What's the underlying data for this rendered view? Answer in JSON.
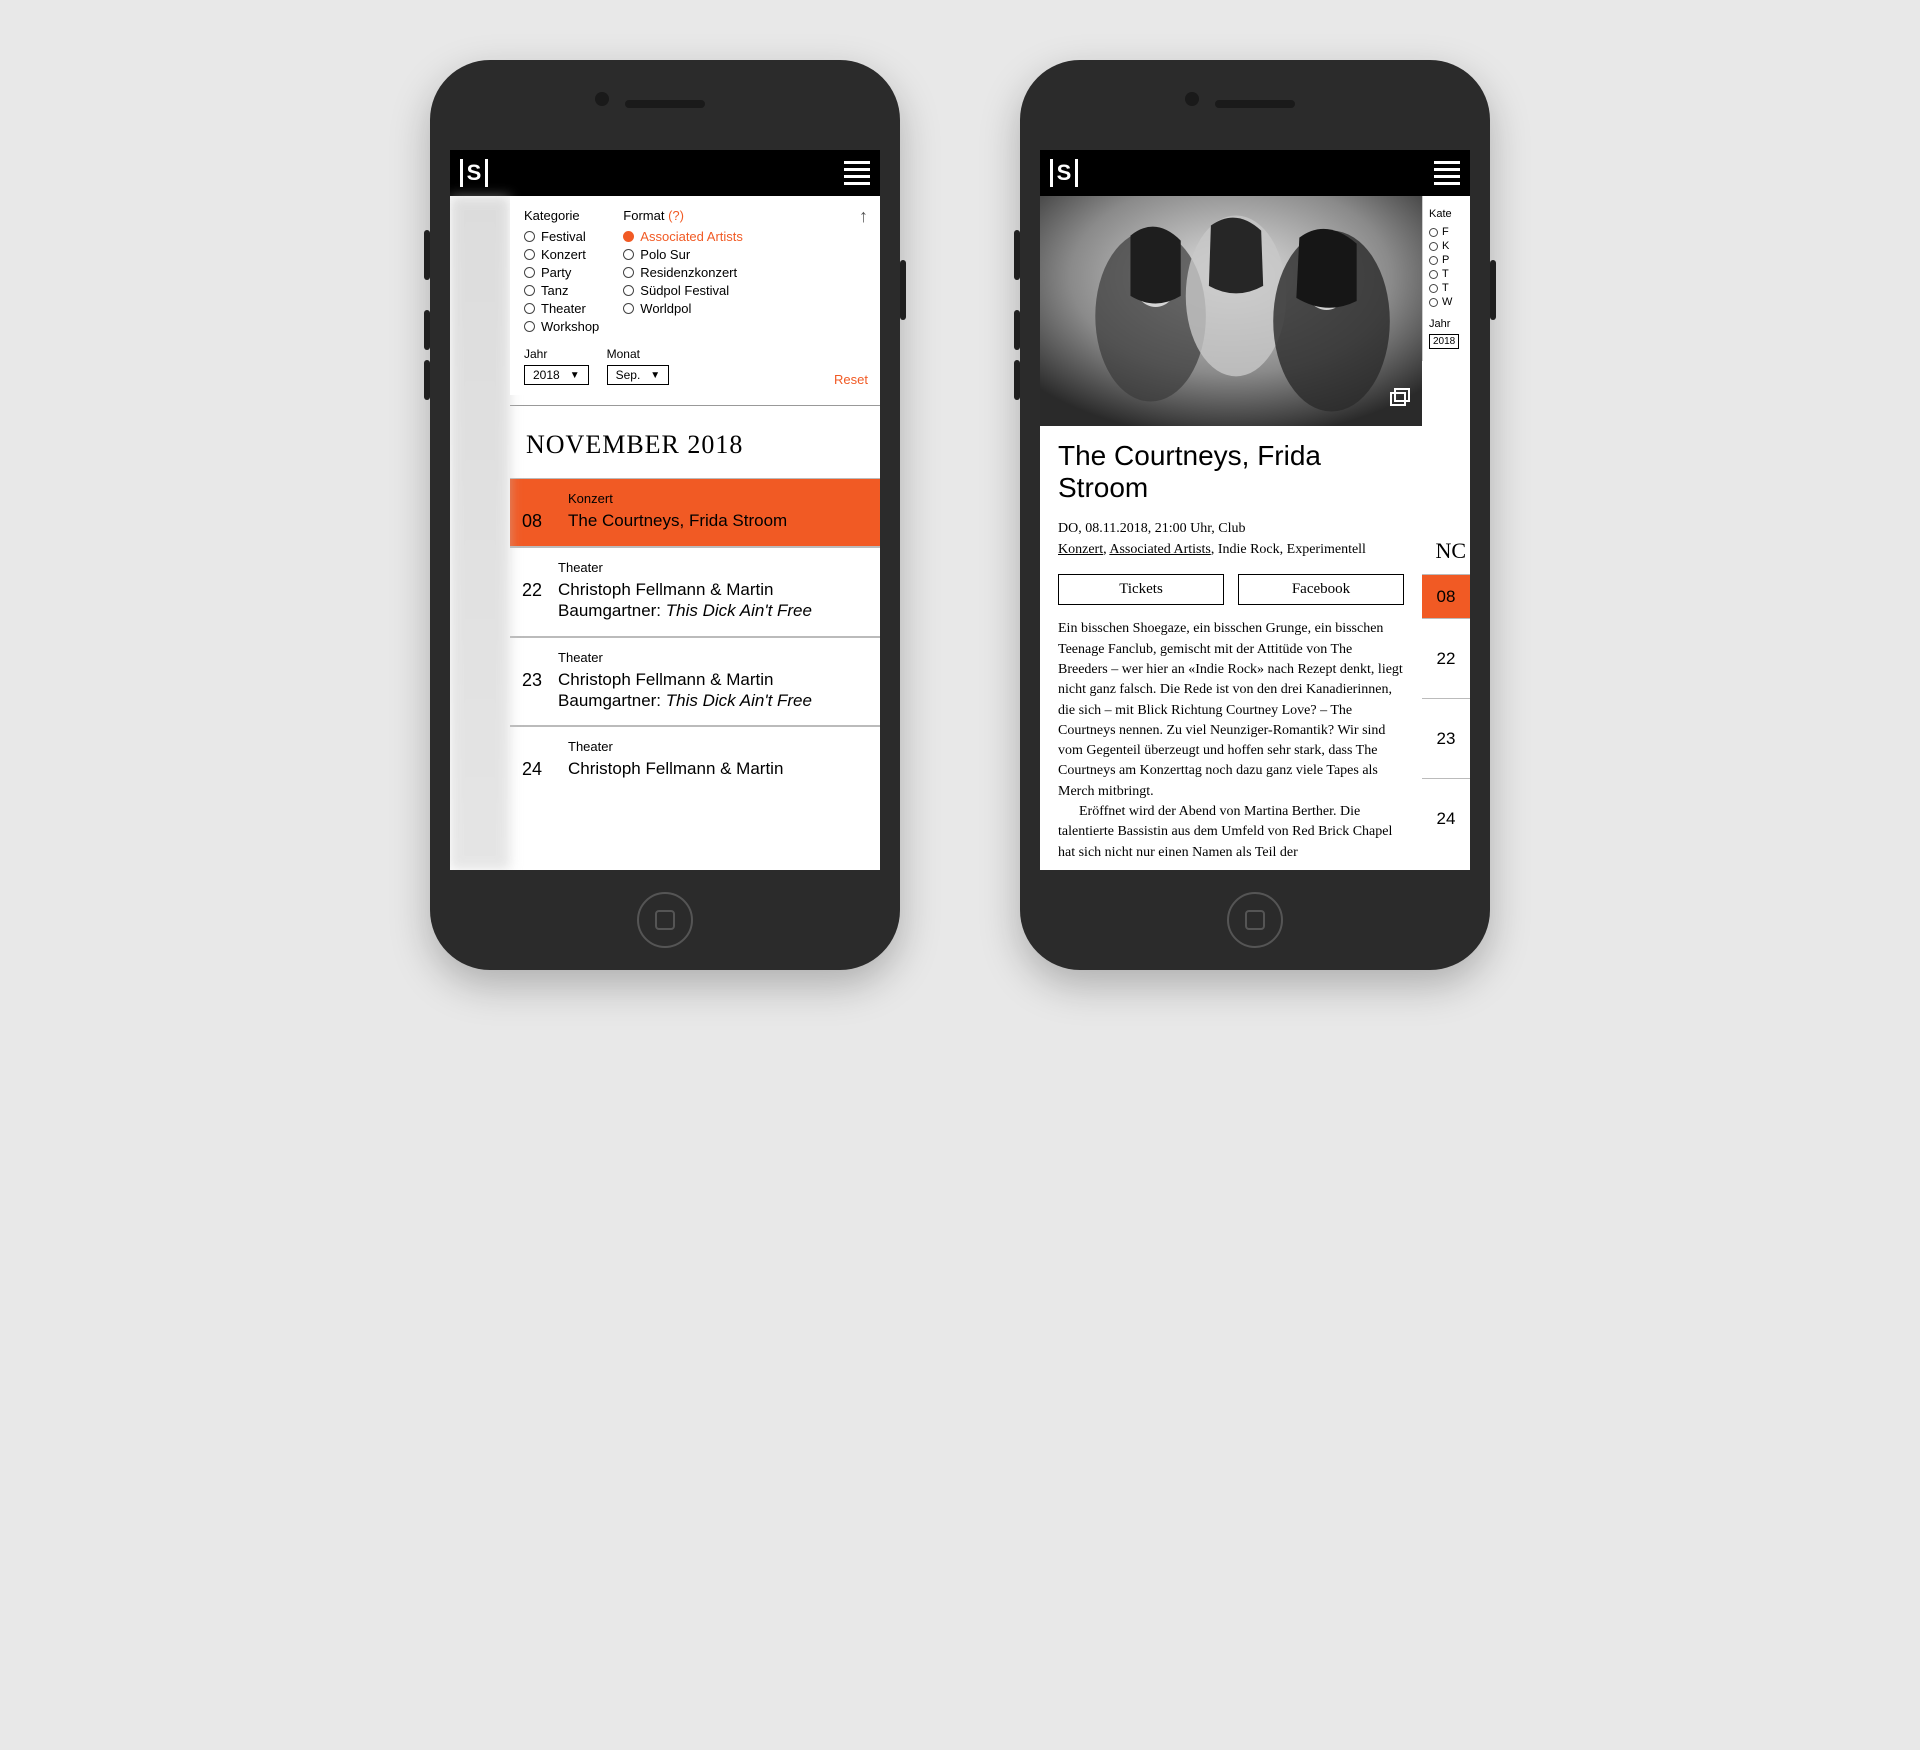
{
  "accent": "#f15a24",
  "phone1": {
    "filters": {
      "kategorie_label": "Kategorie",
      "kategorie": [
        "Festival",
        "Konzert",
        "Party",
        "Tanz",
        "Theater",
        "Workshop"
      ],
      "format_label": "Format",
      "format_help": "(?)",
      "format": [
        "Associated Artists",
        "Polo Sur",
        "Residenzkonzert",
        "Südpol Festival",
        "Worldpol"
      ],
      "format_selected": 0,
      "jahr_label": "Jahr",
      "jahr_value": "2018",
      "monat_label": "Monat",
      "monat_value": "Sep.",
      "reset": "Reset"
    },
    "month_heading": "NOVEMBER 2018",
    "events": [
      {
        "day": "08",
        "category": "Konzert",
        "title": "The Courtneys, Frida Stroom",
        "selected": true
      },
      {
        "day": "22",
        "category": "Theater",
        "title": "Christoph Fellmann & Martin Baumgartner:",
        "title_em": "This Dick Ain't Free"
      },
      {
        "day": "23",
        "category": "Theater",
        "title": "Christoph Fellmann & Martin Baumgartner:",
        "title_em": "This Dick Ain't Free"
      },
      {
        "day": "24",
        "category": "Theater",
        "title": "Christoph Fellmann & Martin"
      }
    ]
  },
  "phone2": {
    "title": "The Courtneys, Frida Stroom",
    "meta_line1": "DO, 08.11.2018, 21:00 Uhr, Club",
    "meta_links": [
      "Konzert",
      "Associated Artists"
    ],
    "meta_tags": "Indie Rock, Experimentell",
    "buttons": {
      "tickets": "Tickets",
      "facebook": "Facebook"
    },
    "description": [
      "Ein bisschen Shoegaze, ein bisschen Grunge, ein bisschen Teenage Fanclub, gemischt mit der Attitüde von The Breeders – wer hier an «Indie Rock» nach Rezept denkt, liegt nicht ganz falsch. Die Rede ist von den drei Kanadierinnen, die sich – mit Blick Richtung Courtney Love? – The Courtneys nennen. Zu viel Neunziger-Romantik? Wir sind vom Gegenteil überzeugt und hoffen sehr stark, dass The Courtneys am Konzerttag noch dazu ganz viele Tapes als Merch mitbringt.",
      "Eröffnet wird der Abend von Martina Berther. Die talentierte Bassistin aus dem Umfeld von Red Brick Chapel hat sich nicht nur einen Namen als Teil der"
    ],
    "strip": {
      "kategorie_label": "Kate",
      "opts": [
        "F",
        "K",
        "P",
        "T",
        "T",
        "W"
      ],
      "jahr_label": "Jahr",
      "jahr_value": "2018",
      "nov": "NC",
      "days": [
        "08",
        "22",
        "23",
        "24"
      ]
    }
  }
}
